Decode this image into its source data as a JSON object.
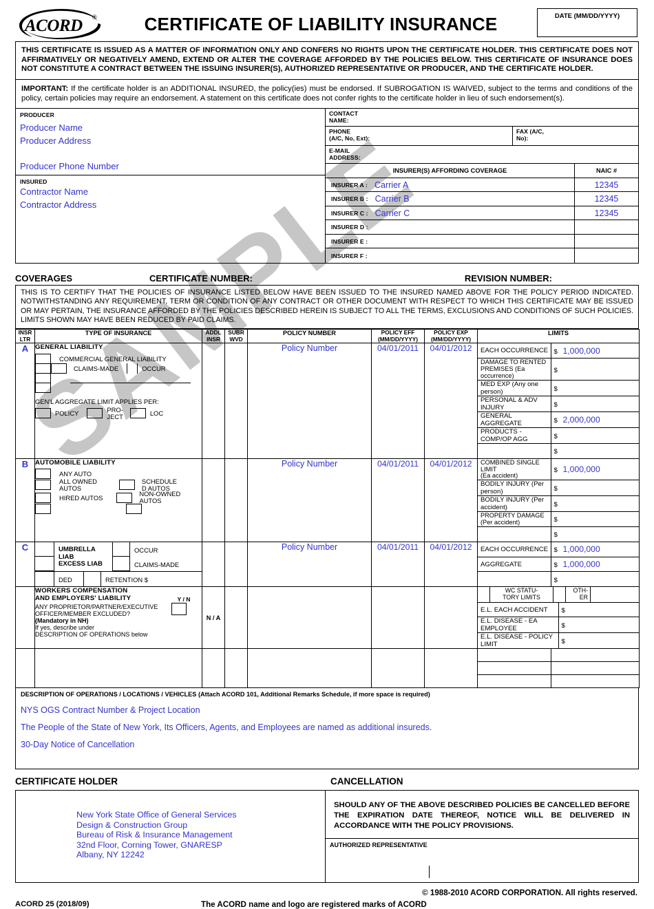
{
  "header": {
    "logo_text": "ACORD",
    "logo_reg": "®",
    "title": "CERTIFICATE OF LIABILITY INSURANCE",
    "date_label": "DATE  (MM/DD/YYYY)",
    "date_value": ""
  },
  "notices": {
    "main": "THIS CERTIFICATE IS ISSUED AS A MATTER OF INFORMATION ONLY AND CONFERS NO RIGHTS UPON THE CERTIFICATE HOLDER. THIS CERTIFICATE DOES NOT AFFIRMATIVELY OR NEGATIVELY AMEND, EXTEND OR ALTER THE COVERAGE AFFORDED BY THE POLICIES BELOW. THIS CERTIFICATE OF INSURANCE DOES NOT CONSTITUTE A CONTRACT BETWEEN THE ISSUING INSURER(S), AUTHORIZED REPRESENTATIVE OR PRODUCER, AND THE CERTIFICATE HOLDER.",
    "important_label": "IMPORTANT:",
    "important": " If the certificate holder is an ADDITIONAL INSURED, the policy(ies) must be endorsed. If SUBROGATION IS WAIVED, subject to the terms and conditions of the policy, certain policies may require an endorsement.  A statement on this certificate does not confer rights to the certificate holder in lieu of such endorsement(s)."
  },
  "producer": {
    "label": "PRODUCER",
    "name": "Producer Name",
    "address": "Producer Address",
    "phone": "Producer Phone Number"
  },
  "insured": {
    "label": "INSURED",
    "name": "Contractor Name",
    "address": "Contractor Address"
  },
  "contact": {
    "name_label": "CONTACT\nNAME:",
    "name_label_l1": "CONTACT",
    "name_label_l2": "NAME:",
    "name_value": "",
    "phone_label_l1": "PHONE",
    "phone_label_l2": "(A/C, No, Ext):",
    "phone_value": "",
    "fax_label_l1": "FAX (A/C,",
    "fax_label_l2": "No):",
    "fax_value": "",
    "email_label_l1": "E-MAIL",
    "email_label_l2": "ADDRESS:",
    "email_value": ""
  },
  "insurers": {
    "header": "INSURER(S) AFFORDING COVERAGE",
    "naic_header": "NAIC #",
    "rows": [
      {
        "label": "INSURER A :",
        "name": "Carrier A",
        "naic": "12345"
      },
      {
        "label": "INSURER B :",
        "name": "Carrier B",
        "naic": "12345"
      },
      {
        "label": "INSURER C :",
        "name": "Carrier C",
        "naic": "12345"
      },
      {
        "label": "INSURER D :",
        "name": "",
        "naic": ""
      },
      {
        "label": "INSURER E :",
        "name": "",
        "naic": ""
      },
      {
        "label": "INSURER F :",
        "name": "",
        "naic": ""
      }
    ]
  },
  "coverages_bar": {
    "coverages": "COVERAGES",
    "certificate_number_label": "CERTIFICATE NUMBER:",
    "certificate_number_value": "",
    "revision_number_label": "REVISION NUMBER:",
    "revision_number_value": ""
  },
  "certify_text": "THIS IS TO CERTIFY THAT THE POLICIES OF INSURANCE LISTED BELOW HAVE BEEN ISSUED TO THE INSURED NAMED ABOVE FOR THE POLICY PERIOD INDICATED. NOTWITHSTANDING ANY REQUIREMENT, TERM OR CONDITION OF ANY CONTRACT OR OTHER DOCUMENT WITH RESPECT TO WHICH THIS CERTIFICATE MAY BE ISSUED OR MAY PERTAIN, THE INSURANCE AFFORDED BY THE POLICIES DESCRIBED HEREIN IS SUBJECT TO ALL THE TERMS, EXCLUSIONS AND CONDITIONS OF SUCH POLICIES. LIMITS SHOWN MAY HAVE BEEN REDUCED BY PAID CLAIMS.",
  "table_headers": {
    "insr_ltr_l1": "INSR",
    "insr_ltr_l2": "LTR",
    "type_of_insurance": "TYPE OF INSURANCE",
    "addl_insr_l1": "ADDL",
    "addl_insr_l2": "INSR",
    "subr_wvd_l1": "SUBR",
    "subr_wvd_l2": "WVD",
    "policy_number": "POLICY NUMBER",
    "policy_eff_l1": "POLICY EFF",
    "policy_eff_l2": "(MM/DD/YYYY)",
    "policy_exp_l1": "POLICY EXP",
    "policy_exp_l2": "(MM/DD/YYYY)",
    "limits": "LIMITS"
  },
  "rows": {
    "general_liability": {
      "insr_ltr": "A",
      "title": "GENERAL  LIABILITY",
      "cgl": "COMMERCIAL GENERAL LIABILITY",
      "claims_made": "CLAIMS-MADE",
      "occur": "OCCUR",
      "aggregate_applies": "GEN'L AGGREGATE LIMIT APPLIES PER:",
      "policy": "POLICY",
      "project_l1": "PRO-",
      "project_l2": "JECT",
      "loc": "LOC",
      "addl_insr": "",
      "subr_wvd": "",
      "policy_number": "Policy Number",
      "policy_eff": "04/01/2011",
      "policy_exp": "04/01/2012",
      "limits": [
        {
          "label": "EACH OCCURRENCE",
          "label2": "",
          "amount": "1,000,000"
        },
        {
          "label": "DAMAGE TO RENTED",
          "label2": "PREMISES (Ea occurrence)",
          "amount": ""
        },
        {
          "label": "MED EXP (Any one person)",
          "label2": "",
          "amount": ""
        },
        {
          "label": "PERSONAL & ADV INJURY",
          "label2": "",
          "amount": ""
        },
        {
          "label": "GENERAL AGGREGATE",
          "label2": "",
          "amount": "2,000,000"
        },
        {
          "label": "PRODUCTS - COMP/OP AGG",
          "label2": "",
          "amount": ""
        },
        {
          "label": "",
          "label2": "",
          "amount": ""
        }
      ]
    },
    "automobile_liability": {
      "insr_ltr": "B",
      "title": "AUTOMOBILE  LIABILITY",
      "any_auto": "ANY AUTO",
      "all_owned_l1": "ALL OWNED",
      "all_owned_l2": "AUTOS",
      "hired_autos": "HIRED AUTOS",
      "scheduled_l1": "SCHEDULE",
      "scheduled_l2": "D AUTOS",
      "non_owned_l1": "NON-OWNED",
      "non_owned_l2": "AUTOS",
      "addl_insr": "",
      "subr_wvd": "",
      "policy_number": "Policy Number",
      "policy_eff": "04/01/2011",
      "policy_exp": "04/01/2012",
      "limits": [
        {
          "label": "COMBINED SINGLE LIMIT",
          "label2": "(Ea accident)",
          "amount": "1,000,000"
        },
        {
          "label": "BODILY INJURY (Per person)",
          "label2": "",
          "amount": ""
        },
        {
          "label": "BODILY INJURY (Per accident)",
          "label2": "",
          "amount": ""
        },
        {
          "label": "PROPERTY DAMAGE",
          "label2": "(Per accident)",
          "amount": ""
        },
        {
          "label": "",
          "label2": "",
          "amount": ""
        }
      ]
    },
    "umbrella": {
      "insr_ltr": "C",
      "umbrella_liab": "UMBRELLA LIAB",
      "excess_liab": "EXCESS LIAB",
      "occur": "OCCUR",
      "claims_made": "CLAIMS-MADE",
      "ded": "DED",
      "retention": "RETENTION $",
      "addl_insr": "",
      "subr_wvd": "",
      "policy_number": "Policy Number",
      "policy_eff": "04/01/2011",
      "policy_exp": "04/01/2012",
      "limits": [
        {
          "label": "EACH OCCURRENCE",
          "label2": "",
          "amount": "1,000,000"
        },
        {
          "label": "AGGREGATE",
          "label2": "",
          "amount": "1,000,000"
        },
        {
          "label": "",
          "label2": "",
          "amount": ""
        }
      ]
    },
    "workers_comp": {
      "insr_ltr": "",
      "title_l1": "WORKERS   COMPENSATION",
      "title_l2": "AND EMPLOYERS' LIABILITY",
      "question_l1": "ANY    PROPRIETOR/PARTNER/EXECUTIVE",
      "question_l2": "OFFICER/MEMBER    EXCLUDED?",
      "mandatory": "(Mandatory in NH)",
      "ifyes_l1": "If yes, describe under",
      "ifyes_l2": "DESCRIPTION OF OPERATIONS below",
      "yn": "Y / N",
      "na": "N / A",
      "wc_statutory_l1": "WC STATU-",
      "wc_statutory_l2": "TORY LIMITS",
      "other_l1": "OTH-",
      "other_l2": "ER",
      "addl_insr": "",
      "subr_wvd": "",
      "policy_number": "",
      "policy_eff": "",
      "policy_exp": "",
      "limits": [
        {
          "label": "E.L. EACH ACCIDENT",
          "label2": "",
          "amount": ""
        },
        {
          "label": "E.L. DISEASE - EA EMPLOYEE",
          "label2": "",
          "amount": ""
        },
        {
          "label": "E.L. DISEASE - POLICY LIMIT",
          "label2": "",
          "amount": ""
        }
      ]
    },
    "blank_row": {
      "insr_ltr": "",
      "type": "",
      "addl_insr": "",
      "subr_wvd": "",
      "policy_number": "",
      "policy_eff": "",
      "policy_exp": "",
      "limits": [
        {
          "label": "",
          "label2": "",
          "amount": ""
        },
        {
          "label": "",
          "label2": "",
          "amount": ""
        },
        {
          "label": "",
          "label2": "",
          "amount": ""
        }
      ]
    }
  },
  "description": {
    "header_bold": "DESCRIPTION OF OPERATIONS / LOCATIONS / VEHICLES",
    "header_rest": "  (Attach ACORD 101, Additional Remarks Schedule, if more space is required)",
    "lines": [
      "NYS OGS Contract Number & Project Location",
      "The People of the State of New York, Its Officers, Agents, and Employees are named as additional insureds.",
      "30-Day Notice of Cancellation"
    ]
  },
  "certificate_holder": {
    "label": "CERTIFICATE  HOLDER",
    "lines": [
      "New York State Office of General Services",
      "Design & Construction Group",
      "Bureau of Risk & Insurance Management",
      "32nd Floor, Corning Tower, GNARESP",
      "Albany, NY 12242"
    ]
  },
  "cancellation": {
    "label": "CANCELLATION",
    "text": "SHOULD ANY OF THE ABOVE DESCRIBED POLICIES BE CANCELLED BEFORE THE EXPIRATION DATE THEREOF, NOTICE WILL BE DELIVERED IN ACCORDANCE WITH THE POLICY PROVISIONS.",
    "authorized_rep": "AUTHORIZED  REPRESENTATIVE",
    "signature": ""
  },
  "footer": {
    "copyright": "© 1988-2010 ACORD CORPORATION.  All rights reserved.",
    "form": "ACORD 25 (2018/09)",
    "trademark": "The ACORD name and logo are registered marks of ACORD"
  },
  "watermark": "SAMPLE",
  "colors": {
    "ink_blue": "#3333cc",
    "black": "#000000",
    "watermark_gray": "#c4c4c4"
  }
}
